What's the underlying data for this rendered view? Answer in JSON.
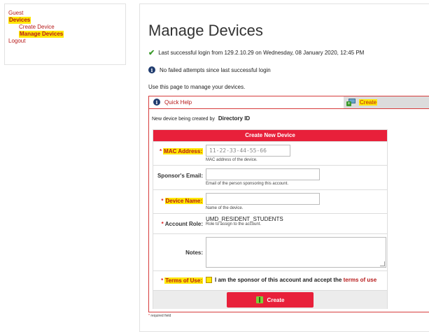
{
  "sidebar": {
    "items": [
      {
        "label": "Guest"
      },
      {
        "label": "Devices"
      },
      {
        "label": "Create Device"
      },
      {
        "label": "Manage Devices"
      },
      {
        "label": "Logout"
      }
    ]
  },
  "page": {
    "title": "Manage Devices",
    "login_message": "Last successful login from 129.2.10.29 on Wednesday, 08 January 2020, 12:45 PM",
    "failed_message": "No failed attempts since last successful login",
    "intro": "Use this page to manage your devices."
  },
  "panel": {
    "quick_help": "Quick Help",
    "create_tab": "Create",
    "created_by_prefix": "New device being created by",
    "created_by_value": "Directory ID"
  },
  "form": {
    "header": "Create New Device",
    "mac": {
      "label": "MAC Address:",
      "placeholder": "11-22-33-44-55-66",
      "help": "MAC address of the device."
    },
    "sponsor": {
      "label": "Sponsor's Email:",
      "value": "",
      "help": "Email of the person sponsoring this account."
    },
    "device_name": {
      "label": "Device Name:",
      "value": "",
      "help": "Name of the device."
    },
    "account_role": {
      "label": "Account Role:",
      "value": "UMD_RESIDENT_STUDENTS",
      "help": "Role to assign to the account."
    },
    "notes": {
      "label": "Notes:",
      "value": ""
    },
    "terms": {
      "label": "Terms of Use:",
      "text": "I am the sponsor of this account and accept the",
      "link": "terms of use"
    },
    "required_marker": "*",
    "submit_label": "Create"
  },
  "footer": {
    "required_note": "required field"
  },
  "colors": {
    "accent": "#e8203a",
    "highlight": "#ffe800",
    "link": "#b71b1b"
  }
}
